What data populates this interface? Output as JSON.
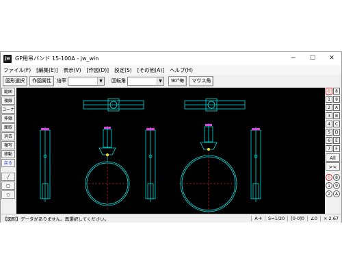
{
  "window": {
    "title": "GP用吊バンド 15-100A - jw_win",
    "icon": "jw",
    "minimize": "─",
    "maximize": "☐",
    "close": "✕"
  },
  "menu": [
    "ファイル(F)",
    "[編集(E)]",
    "表示(V)",
    "[作図(D)]",
    "設定(S)",
    "[その他(A)]",
    "ヘルプ(H)"
  ],
  "toolbar": {
    "select_figure": "図形選択",
    "figure_attr": "作図属性",
    "scale_label": "倍率",
    "scale_value": "",
    "rotation_label": "回転角",
    "rotation_value": "",
    "rotate90": "90°毎",
    "mouse_angle": "マウス角"
  },
  "left_tools": [
    {
      "label": "範囲",
      "color": "#000000"
    },
    {
      "label": "複線",
      "color": "#000000"
    },
    {
      "label": "コーナー",
      "color": "#000000"
    },
    {
      "label": "伸縮",
      "color": "#000000"
    },
    {
      "label": "面取",
      "color": "#000000"
    },
    {
      "label": "消去",
      "color": "#000000"
    },
    {
      "label": "複写",
      "color": "#000000"
    },
    {
      "label": "移動",
      "color": "#000000"
    },
    {
      "label": "戻る",
      "color": "#1d3fd0"
    }
  ],
  "left_shapes": [
    "╱",
    "□",
    "○"
  ],
  "right_layers": [
    [
      "0",
      "8"
    ],
    [
      "1",
      "9"
    ],
    [
      "2",
      "A"
    ],
    [
      "3",
      "B"
    ],
    [
      "4",
      "C"
    ],
    [
      "5",
      "D"
    ],
    [
      "6",
      "E"
    ],
    [
      "7",
      "F"
    ]
  ],
  "right_all": "All",
  "right_x": "><",
  "right_groups": [
    [
      "0",
      "8"
    ],
    [
      "1",
      "9"
    ],
    [
      "2",
      "A"
    ]
  ],
  "status": {
    "message": "【図形】データがありません。再選択してください。",
    "paper": "A-4",
    "scale": "S=1/20",
    "group": "[0-0]0",
    "angle": "∠0",
    "zoom": "× 2.67"
  }
}
